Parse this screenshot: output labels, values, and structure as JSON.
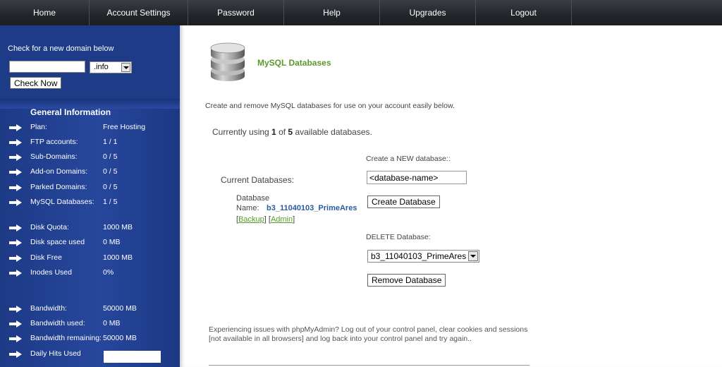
{
  "nav": {
    "items": [
      {
        "label": "Home"
      },
      {
        "label": "Account Settings"
      },
      {
        "label": "Password"
      },
      {
        "label": "Help"
      },
      {
        "label": "Upgrades"
      },
      {
        "label": "Logout"
      }
    ]
  },
  "sidebar": {
    "domain_check": {
      "label": "Check for a new domain below",
      "input_value": "",
      "tld_selected": ".info",
      "button_label": "Check Now"
    },
    "general_info": {
      "title": "General Information",
      "rows": [
        {
          "label": "Plan:",
          "value": "Free Hosting"
        },
        {
          "label": "FTP accounts:",
          "value": "1 / 1"
        },
        {
          "label": "Sub-Domains:",
          "value": "0 / 5"
        },
        {
          "label": "Add-on Domains:",
          "value": "0 / 5"
        },
        {
          "label": "Parked Domains:",
          "value": "0 / 5"
        },
        {
          "label": "MySQL Databases:",
          "value": "1 / 5"
        },
        {
          "label": "Disk Quota:",
          "value": "1000 MB"
        },
        {
          "label": "Disk space used",
          "value": "0 MB"
        },
        {
          "label": "Disk Free",
          "value": "1000 MB"
        },
        {
          "label": "Inodes Used",
          "value": "0%"
        },
        {
          "label": "Bandwidth:",
          "value": "50000 MB"
        },
        {
          "label": "Bandwidth used:",
          "value": "0 MB"
        },
        {
          "label": "Bandwidth remaining:",
          "value": "50000 MB"
        },
        {
          "label": "Daily Hits Used",
          "value": ""
        }
      ]
    }
  },
  "main": {
    "title": "MySQL Databases",
    "intro": "Create and remove MySQL databases for use on your account easily below.",
    "usage": {
      "prefix": "Currently using ",
      "used": "1",
      "middle": " of ",
      "total": "5",
      "suffix": " available databases."
    },
    "create": {
      "label": "Create a NEW database::",
      "input_value": "<database-name>",
      "button_label": "Create Database"
    },
    "current": {
      "label": "Current Databases:",
      "name_label_line1": "Database",
      "name_label_line2": "Name:",
      "db_name": "b3_11040103_PrimeAres",
      "backup_link": "Backup",
      "admin_link": "Admin"
    },
    "delete": {
      "label": "DELETE Database:",
      "selected": "b3_11040103_PrimeAres",
      "button_label": "Remove Database"
    },
    "footer_note": "Experiencing issues with phpMyAdmin? Log out of your control panel, clear cookies and sessions [not available in all browsers] and log back into your control panel and try again.."
  },
  "colors": {
    "accent_green": "#5a9a2a",
    "link_blue": "#2a5aa0",
    "sidebar_blue": "#27479c"
  }
}
